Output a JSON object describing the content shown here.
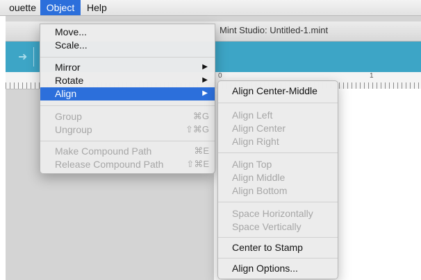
{
  "menubar": {
    "items": [
      {
        "label": "ouette"
      },
      {
        "label": "Object"
      },
      {
        "label": "Help"
      }
    ]
  },
  "window": {
    "title": "Mint Studio: Untitled-1.mint"
  },
  "ruler": {
    "labels": [
      "0",
      "1"
    ]
  },
  "object_menu": {
    "items": [
      {
        "label": "Move..."
      },
      {
        "label": "Scale..."
      },
      {
        "label": "Mirror"
      },
      {
        "label": "Rotate"
      },
      {
        "label": "Align"
      },
      {
        "label": "Group",
        "shortcut": "⌘G"
      },
      {
        "label": "Ungroup",
        "shortcut": "⇧⌘G"
      },
      {
        "label": "Make Compound Path",
        "shortcut": "⌘E"
      },
      {
        "label": "Release Compound Path",
        "shortcut": "⇧⌘E"
      }
    ]
  },
  "align_submenu": {
    "items": [
      {
        "label": "Align Center-Middle"
      },
      {
        "label": "Align Left"
      },
      {
        "label": "Align Center"
      },
      {
        "label": "Align Right"
      },
      {
        "label": "Align Top"
      },
      {
        "label": "Align Middle"
      },
      {
        "label": "Align Bottom"
      },
      {
        "label": "Space Horizontally"
      },
      {
        "label": "Space Vertically"
      },
      {
        "label": "Center to Stamp"
      },
      {
        "label": "Align Options..."
      }
    ]
  },
  "colors": {
    "highlight": "#2c6fdb",
    "toolbar": "#3da5c6",
    "disabled_text": "#a6a6a6"
  },
  "icons": {
    "submenu_arrow": "chevron-right-icon",
    "toolbar_arrow": "arrow-right-icon"
  }
}
